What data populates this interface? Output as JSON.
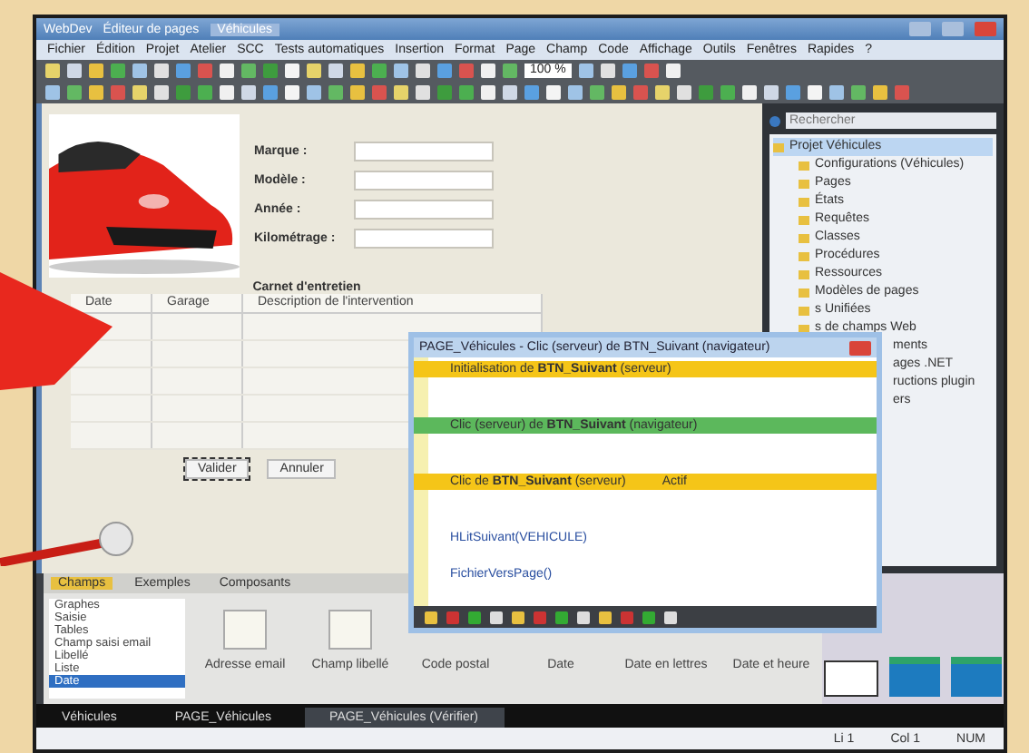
{
  "window": {
    "title": "WebDev",
    "document": "Éditeur de pages",
    "tab": "Véhicules"
  },
  "menu": [
    "Fichier",
    "Édition",
    "Projet",
    "Atelier",
    "SCC",
    "Tests automatiques",
    "Insertion",
    "Format",
    "Page",
    "Champ",
    "Code",
    "Affichage",
    "Outils",
    "Fenêtres",
    "Rapides",
    "?"
  ],
  "toolbar": {
    "zoom": "100 %"
  },
  "form": {
    "fields": [
      {
        "label": "Marque :"
      },
      {
        "label": "Modèle :"
      },
      {
        "label": "Année :"
      },
      {
        "label": "Kilométrage :"
      }
    ],
    "table_title": "Carnet d'entretien",
    "columns": [
      "Date",
      "Garage",
      "Description de l'intervention"
    ],
    "buttons": [
      "Valider",
      "Annuler"
    ]
  },
  "code_window": {
    "title": "PAGE_Véhicules - Clic (serveur) de BTN_Suivant (navigateur)",
    "lines": [
      {
        "kind": "header",
        "color": "#f5c518",
        "text": "Initialisation de **BTN_Suivant** (serveur)"
      },
      {
        "kind": "header",
        "color": "#5cb85c",
        "text": "Clic (serveur) de **BTN_Suivant** (navigateur)"
      },
      {
        "kind": "header",
        "color": "#f5c518",
        "text": "Clic de **BTN_Suivant** (serveur)",
        "note": "Actif"
      },
      {
        "kind": "code",
        "text": "HLitSuivant(VEHICULE)"
      },
      {
        "kind": "code",
        "text": "FichierVersPage()"
      }
    ]
  },
  "explorer": {
    "search": {
      "placeholder": "Rechercher"
    },
    "tree": [
      {
        "label": "Projet Véhicules",
        "selected": true,
        "children": [
          {
            "label": "Configurations (Véhicules)",
            "selected": false
          },
          {
            "label": "Pages",
            "selected": false
          },
          {
            "label": "États",
            "selected": false
          },
          {
            "label": "Requêtes",
            "selected": false
          },
          {
            "label": "Classes",
            "selected": false
          },
          {
            "label": "Procédures",
            "selected": false
          },
          {
            "label": "Ressources",
            "selected": false
          },
          {
            "label": "Modèles de pages",
            "selected": false
          },
          {
            "label": "s Unifiées",
            "selected": false
          },
          {
            "label": "s de champs Web",
            "selected": false
          },
          {
            "label": "ments",
            "selected": false
          },
          {
            "label": "ages .NET",
            "selected": false
          },
          {
            "label": "ructions plugin",
            "selected": false
          },
          {
            "label": "ers",
            "selected": false
          }
        ]
      }
    ]
  },
  "palette": {
    "tabs": [
      {
        "label": "Champs",
        "selected": true
      },
      {
        "label": "Exemples",
        "selected": false
      },
      {
        "label": "Composants",
        "selected": false
      }
    ],
    "categories": [
      {
        "label": "Graphes",
        "selected": false
      },
      {
        "label": "Saisie",
        "selected": false
      },
      {
        "label": "Tables",
        "selected": false
      },
      {
        "label": "Champ saisi email",
        "selected": false
      },
      {
        "label": "Libellé",
        "selected": false
      },
      {
        "label": "Liste",
        "selected": false
      },
      {
        "label": "Date",
        "selected": true
      }
    ],
    "items": [
      "Adresse email",
      "Champ libellé",
      "Code postal",
      "Date",
      "Date en lettres",
      "Date et heure"
    ]
  },
  "doc_tabs": [
    {
      "label": "Véhicules",
      "selected": false
    },
    {
      "label": "PAGE_Véhicules",
      "selected": false
    },
    {
      "label": "PAGE_Véhicules (Vérifier)",
      "selected": true
    }
  ],
  "status_bar": [
    "Li 1",
    "Col 1",
    "NUM"
  ]
}
